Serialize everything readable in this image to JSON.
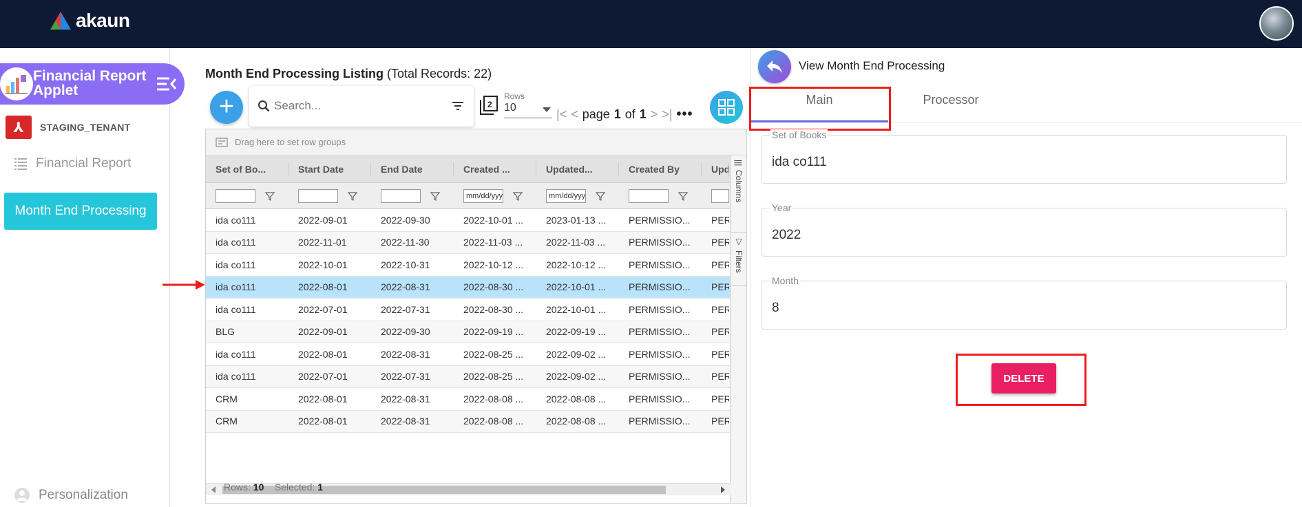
{
  "brand": {
    "name": "akaun"
  },
  "sidebar": {
    "applet_title": "Financial Report Applet",
    "tenant": "STAGING_TENANT",
    "menu_financial": "Financial Report",
    "menu_active": "Month End Processing",
    "personalization": "Personalization"
  },
  "listing": {
    "title": "Month End Processing Listing",
    "total": "(Total Records: 22)",
    "search_placeholder": "Search...",
    "rows_label": "Rows",
    "rows_value": "10",
    "page_label": "page",
    "page_current": "1",
    "page_of": "of",
    "page_total": "1",
    "group_hint": "Drag here to set row groups",
    "columns": [
      "Set of Bo...",
      "Start Date",
      "End Date",
      "Created ...",
      "Updated...",
      "Created By",
      "Upd"
    ],
    "filter_placeholders": [
      "",
      "",
      "",
      "mm/dd/yyyy",
      "mm/dd/yyyy",
      "",
      ""
    ],
    "side_columns": "Columns",
    "side_filters": "Filters",
    "rows": [
      [
        "ida co111",
        "2022-09-01",
        "2022-09-30",
        "2022-10-01 ...",
        "2023-01-13 ...",
        "PERMISSIO...",
        "PERI"
      ],
      [
        "ida co111",
        "2022-11-01",
        "2022-11-30",
        "2022-11-03 ...",
        "2022-11-03 ...",
        "PERMISSIO...",
        "PERI"
      ],
      [
        "ida co111",
        "2022-10-01",
        "2022-10-31",
        "2022-10-12 ...",
        "2022-10-12 ...",
        "PERMISSIO...",
        "PERI"
      ],
      [
        "ida co111",
        "2022-08-01",
        "2022-08-31",
        "2022-08-30 ...",
        "2022-10-01 ...",
        "PERMISSIO...",
        "PERI"
      ],
      [
        "ida co111",
        "2022-07-01",
        "2022-07-31",
        "2022-08-30 ...",
        "2022-10-01 ...",
        "PERMISSIO...",
        "PERI"
      ],
      [
        "BLG",
        "2022-09-01",
        "2022-09-30",
        "2022-09-19 ...",
        "2022-09-19 ...",
        "PERMISSIO...",
        "PERI"
      ],
      [
        "ida co111",
        "2022-08-01",
        "2022-08-31",
        "2022-08-25 ...",
        "2022-09-02 ...",
        "PERMISSIO...",
        "PERI"
      ],
      [
        "ida co111",
        "2022-07-01",
        "2022-07-31",
        "2022-08-25 ...",
        "2022-09-02 ...",
        "PERMISSIO...",
        "PERI"
      ],
      [
        "CRM",
        "2022-08-01",
        "2022-08-31",
        "2022-08-08 ...",
        "2022-08-08 ...",
        "PERMISSIO...",
        "PERI"
      ],
      [
        "CRM",
        "2022-08-01",
        "2022-08-31",
        "2022-08-08 ...",
        "2022-08-08 ...",
        "PERMISSIO...",
        "PERI"
      ]
    ],
    "selected_row": 3,
    "footer_rows_label": "Rows:",
    "footer_rows_value": "10",
    "footer_selected_label": "Selected:",
    "footer_selected_value": "1"
  },
  "detail": {
    "title": "View Month End Processing",
    "tab_main": "Main",
    "tab_processor": "Processor",
    "set_of_books_label": "Set of Books",
    "set_of_books_value": "ida co111",
    "year_label": "Year",
    "year_value": "2022",
    "month_label": "Month",
    "month_value": "8",
    "delete_label": "DELETE"
  },
  "colors": {
    "topbar": "#0e1a33",
    "applet_banner": "#8b6cf5",
    "active_menu": "#26c6da",
    "selected_row": "#b9e3fb",
    "delete_button": "#e91e63",
    "highlight": "#ee1c1c"
  }
}
